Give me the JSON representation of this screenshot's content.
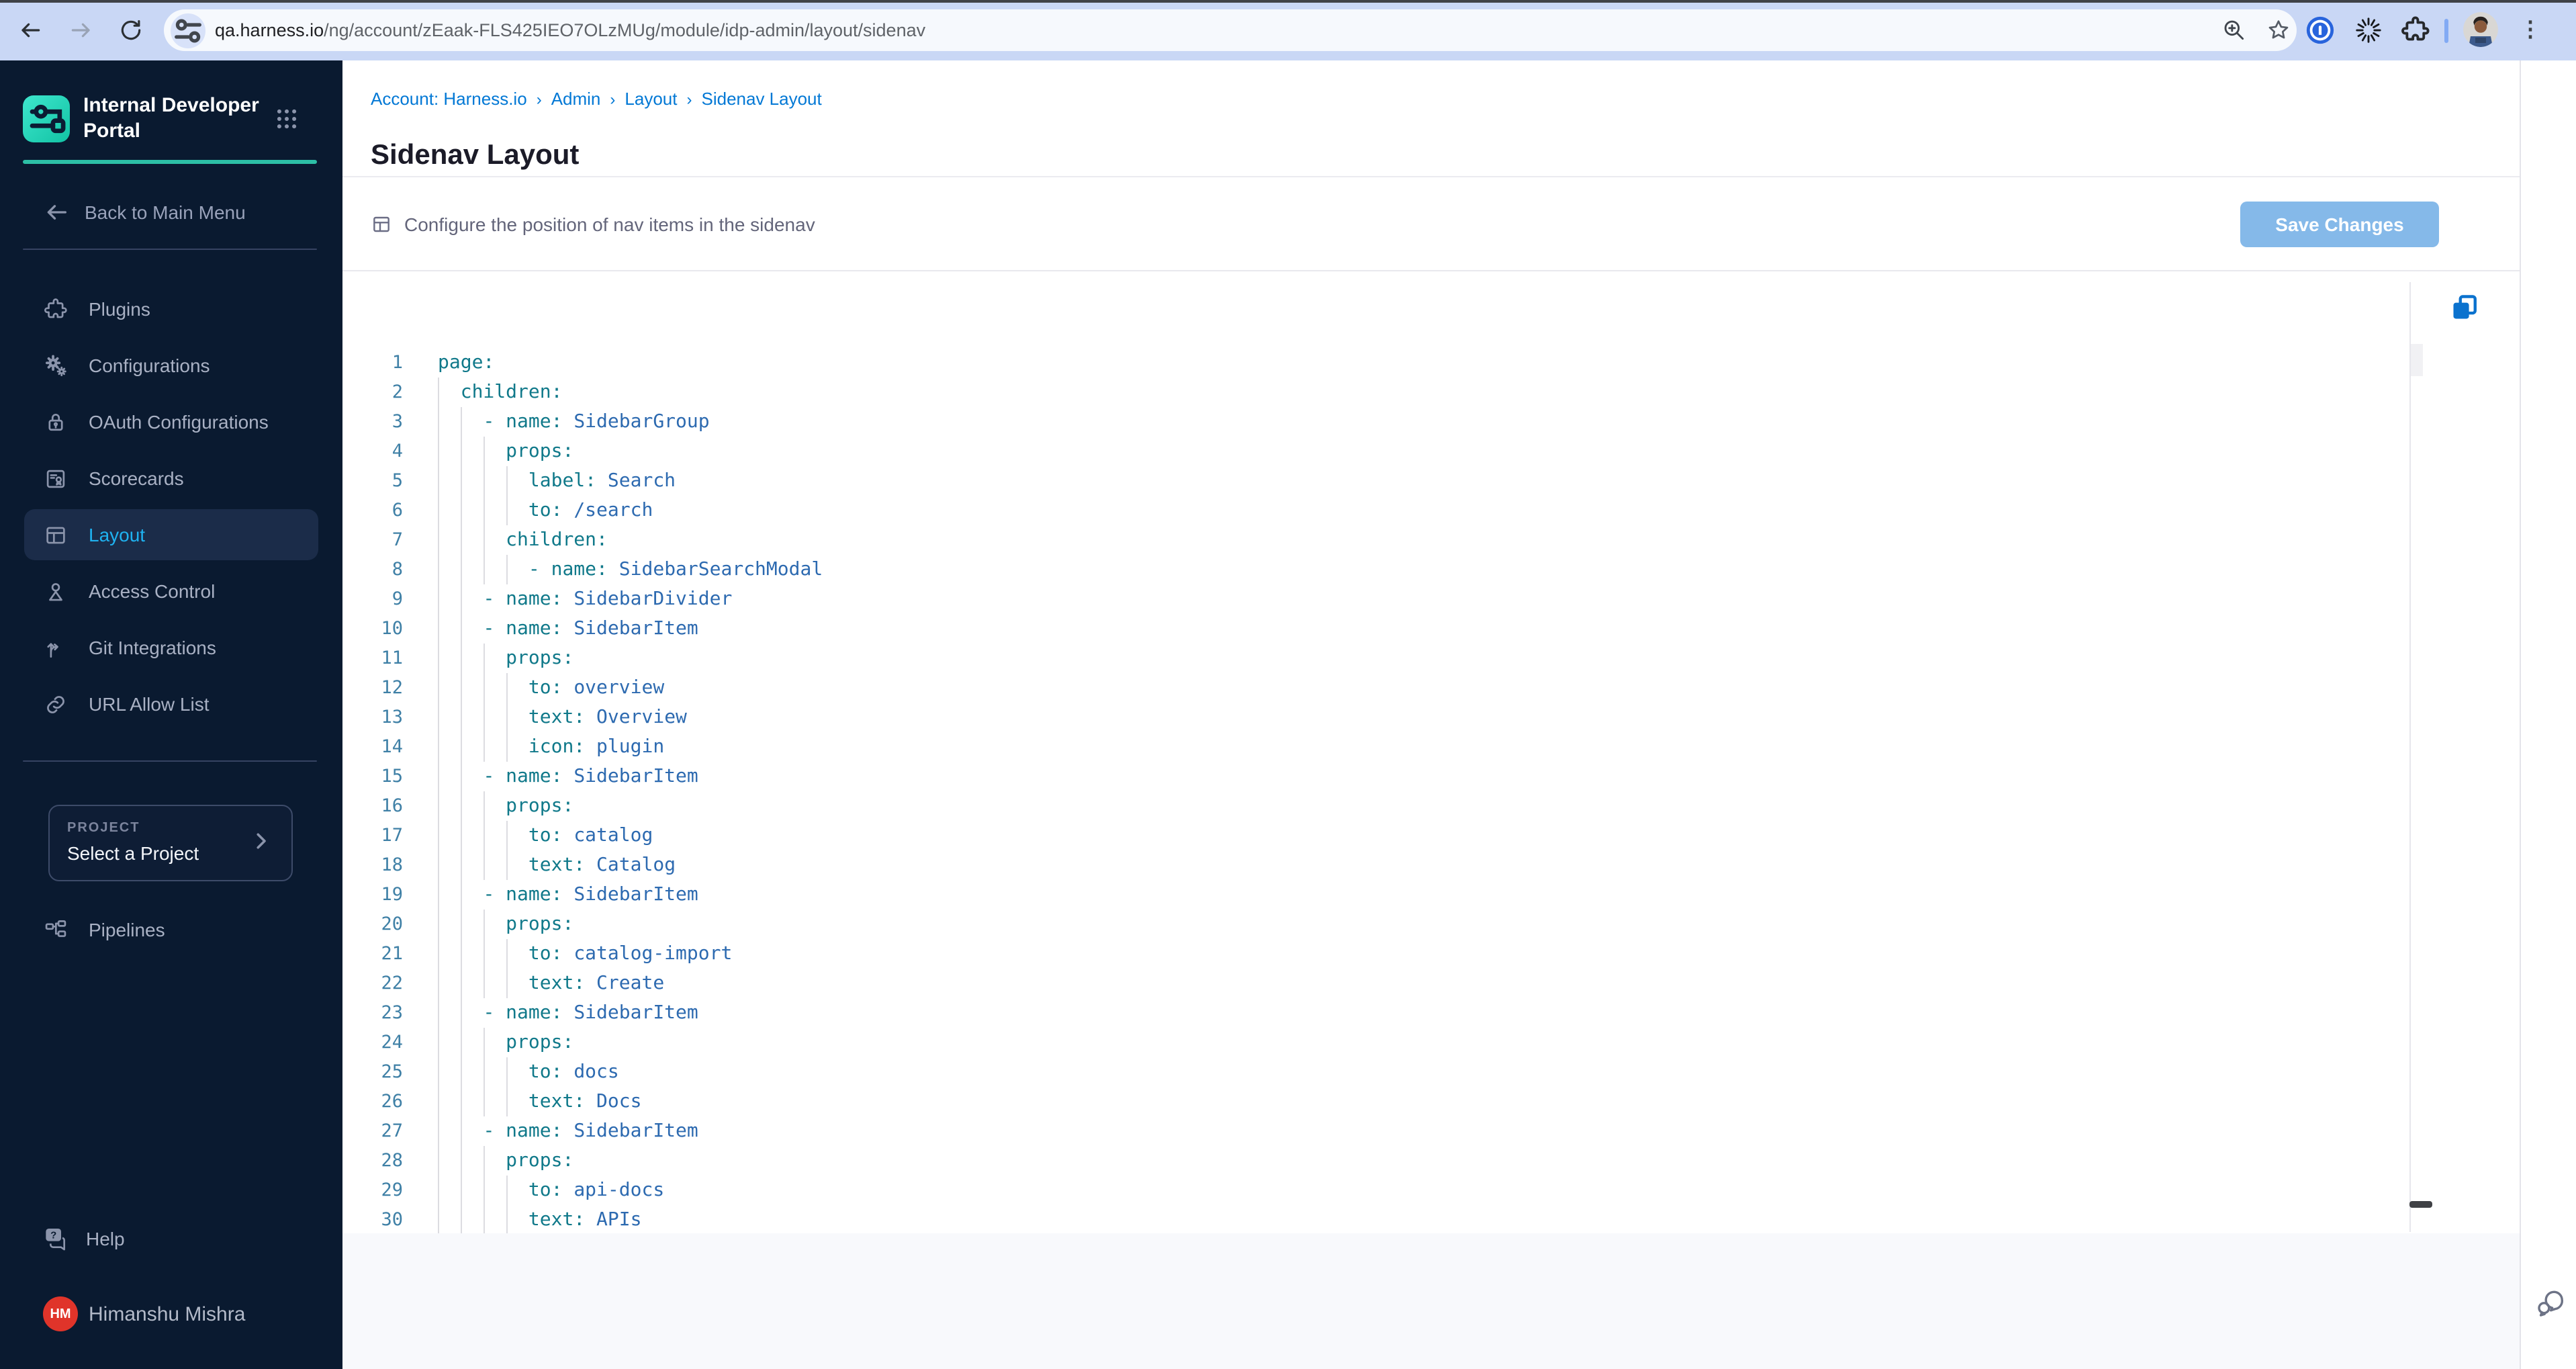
{
  "browser": {
    "url_host": "qa.harness.io",
    "url_path": "/ng/account/zEaak-FLS425IEO7OLzMUg/module/idp-admin/layout/sidenav"
  },
  "sidebar": {
    "product_title": "Internal Developer Portal",
    "back_label": "Back to Main Menu",
    "menu": [
      {
        "label": "Plugins",
        "icon": "puzzle",
        "selected": false
      },
      {
        "label": "Configurations",
        "icon": "gears",
        "selected": false
      },
      {
        "label": "OAuth Configurations",
        "icon": "lock",
        "selected": false
      },
      {
        "label": "Scorecards",
        "icon": "scorecard",
        "selected": false
      },
      {
        "label": "Layout",
        "icon": "layout",
        "selected": true
      },
      {
        "label": "Access Control",
        "icon": "person",
        "selected": false
      },
      {
        "label": "Git Integrations",
        "icon": "git",
        "selected": false
      },
      {
        "label": "URL Allow List",
        "icon": "link",
        "selected": false
      }
    ],
    "project": {
      "label": "PROJECT",
      "value": "Select a Project"
    },
    "pipelines_label": "Pipelines",
    "help_label": "Help",
    "user": {
      "initials": "HM",
      "name": "Himanshu Mishra"
    }
  },
  "breadcrumb": [
    "Account: Harness.io",
    "Admin",
    "Layout",
    "Sidenav Layout"
  ],
  "page": {
    "title": "Sidenav Layout"
  },
  "config_bar": {
    "text": "Configure the position of nav items in the sidenav",
    "save_label": "Save Changes"
  },
  "editor": {
    "yaml_lines": [
      {
        "no": 1,
        "col": 0,
        "dash": false,
        "key": "page",
        "value": ""
      },
      {
        "no": 2,
        "col": 2,
        "dash": false,
        "key": "children",
        "value": ""
      },
      {
        "no": 3,
        "col": 4,
        "dash": true,
        "key": "name",
        "value": "SidebarGroup"
      },
      {
        "no": 4,
        "col": 6,
        "dash": false,
        "key": "props",
        "value": ""
      },
      {
        "no": 5,
        "col": 8,
        "dash": false,
        "key": "label",
        "value": "Search"
      },
      {
        "no": 6,
        "col": 8,
        "dash": false,
        "key": "to",
        "value": "/search"
      },
      {
        "no": 7,
        "col": 6,
        "dash": false,
        "key": "children",
        "value": ""
      },
      {
        "no": 8,
        "col": 8,
        "dash": true,
        "key": "name",
        "value": "SidebarSearchModal"
      },
      {
        "no": 9,
        "col": 4,
        "dash": true,
        "key": "name",
        "value": "SidebarDivider"
      },
      {
        "no": 10,
        "col": 4,
        "dash": true,
        "key": "name",
        "value": "SidebarItem"
      },
      {
        "no": 11,
        "col": 6,
        "dash": false,
        "key": "props",
        "value": ""
      },
      {
        "no": 12,
        "col": 8,
        "dash": false,
        "key": "to",
        "value": "overview"
      },
      {
        "no": 13,
        "col": 8,
        "dash": false,
        "key": "text",
        "value": "Overview"
      },
      {
        "no": 14,
        "col": 8,
        "dash": false,
        "key": "icon",
        "value": "plugin"
      },
      {
        "no": 15,
        "col": 4,
        "dash": true,
        "key": "name",
        "value": "SidebarItem"
      },
      {
        "no": 16,
        "col": 6,
        "dash": false,
        "key": "props",
        "value": ""
      },
      {
        "no": 17,
        "col": 8,
        "dash": false,
        "key": "to",
        "value": "catalog"
      },
      {
        "no": 18,
        "col": 8,
        "dash": false,
        "key": "text",
        "value": "Catalog"
      },
      {
        "no": 19,
        "col": 4,
        "dash": true,
        "key": "name",
        "value": "SidebarItem"
      },
      {
        "no": 20,
        "col": 6,
        "dash": false,
        "key": "props",
        "value": ""
      },
      {
        "no": 21,
        "col": 8,
        "dash": false,
        "key": "to",
        "value": "catalog-import"
      },
      {
        "no": 22,
        "col": 8,
        "dash": false,
        "key": "text",
        "value": "Create"
      },
      {
        "no": 23,
        "col": 4,
        "dash": true,
        "key": "name",
        "value": "SidebarItem"
      },
      {
        "no": 24,
        "col": 6,
        "dash": false,
        "key": "props",
        "value": ""
      },
      {
        "no": 25,
        "col": 8,
        "dash": false,
        "key": "to",
        "value": "docs"
      },
      {
        "no": 26,
        "col": 8,
        "dash": false,
        "key": "text",
        "value": "Docs"
      },
      {
        "no": 27,
        "col": 4,
        "dash": true,
        "key": "name",
        "value": "SidebarItem"
      },
      {
        "no": 28,
        "col": 6,
        "dash": false,
        "key": "props",
        "value": ""
      },
      {
        "no": 29,
        "col": 8,
        "dash": false,
        "key": "to",
        "value": "api-docs"
      },
      {
        "no": 30,
        "col": 8,
        "dash": false,
        "key": "text",
        "value": "APIs"
      }
    ]
  },
  "colors": {
    "accent_blue": "#0278d5",
    "selected_cyan": "#1fb2f0",
    "brand_teal": "#2dbfa6",
    "save_button_bg": "#85b9e9",
    "code_key": "#10798a",
    "code_value": "#2d6ab0",
    "code_line_number": "#3f80a6",
    "avatar_red": "#e0342a",
    "copy_icon_blue": "#0b72ce"
  }
}
